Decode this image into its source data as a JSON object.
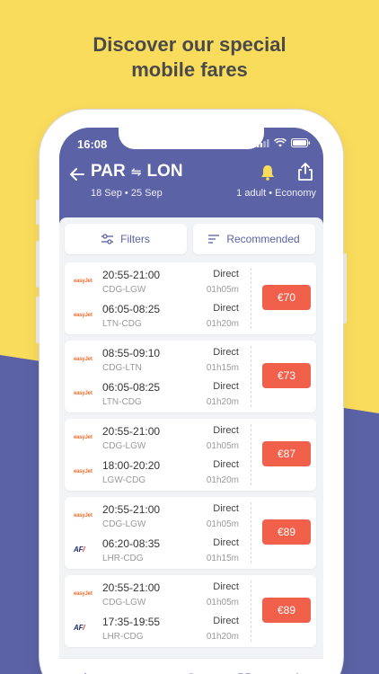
{
  "promo": {
    "headline_line1": "Discover our special",
    "headline_line2": "mobile fares",
    "bg_yellow": "#f9dc5c",
    "bg_purple": "#5b62a5"
  },
  "status_bar": {
    "time": "16:08",
    "icons": [
      "signal-icon",
      "wifi-icon",
      "battery-icon"
    ]
  },
  "header": {
    "origin": "PAR",
    "destination": "LON",
    "dates": "18 Sep • 25 Sep",
    "passengers": "1 adult • Economy",
    "icons": [
      "back-arrow-icon",
      "swap-icon",
      "bell-icon",
      "share-icon"
    ]
  },
  "toolbar": {
    "filters_label": "Filters",
    "sort_label": "Recommended",
    "icons": [
      "sliders-icon",
      "sort-lines-icon"
    ]
  },
  "results": [
    {
      "price": "€70",
      "outbound": {
        "airline": "easyJet",
        "time": "20:55-21:00",
        "airports": "CDG-LGW",
        "stops": "Direct",
        "duration": "01h05m"
      },
      "return": {
        "airline": "easyJet",
        "time": "06:05-08:25",
        "airports": "LTN-CDG",
        "stops": "Direct",
        "duration": "01h20m"
      }
    },
    {
      "price": "€73",
      "outbound": {
        "airline": "easyJet",
        "time": "08:55-09:10",
        "airports": "CDG-LTN",
        "stops": "Direct",
        "duration": "01h15m"
      },
      "return": {
        "airline": "easyJet",
        "time": "06:05-08:25",
        "airports": "LTN-CDG",
        "stops": "Direct",
        "duration": "01h20m"
      }
    },
    {
      "price": "€87",
      "outbound": {
        "airline": "easyJet",
        "time": "20:55-21:00",
        "airports": "CDG-LGW",
        "stops": "Direct",
        "duration": "01h05m"
      },
      "return": {
        "airline": "easyJet",
        "time": "18:00-20:20",
        "airports": "LGW-CDG",
        "stops": "Direct",
        "duration": "01h20m"
      }
    },
    {
      "price": "€89",
      "outbound": {
        "airline": "easyJet",
        "time": "20:55-21:00",
        "airports": "CDG-LGW",
        "stops": "Direct",
        "duration": "01h05m"
      },
      "return": {
        "airline": "AF",
        "time": "06:20-08:35",
        "airports": "LHR-CDG",
        "stops": "Direct",
        "duration": "01h15m"
      }
    },
    {
      "price": "€89",
      "outbound": {
        "airline": "easyJet",
        "time": "20:55-21:00",
        "airports": "CDG-LGW",
        "stops": "Direct",
        "duration": "01h05m"
      },
      "return": {
        "airline": "AF",
        "time": "17:35-19:55",
        "airports": "LHR-CDG",
        "stops": "Direct",
        "duration": "01h20m"
      }
    }
  ],
  "tabbar": {
    "tabs": [
      "home-icon",
      "book-icon",
      "bell-icon",
      "heart-icon",
      "gear-icon"
    ],
    "active_color": "#5b62a5",
    "inactive_color": "#a7a9c4"
  },
  "price_color": "#f0604b"
}
